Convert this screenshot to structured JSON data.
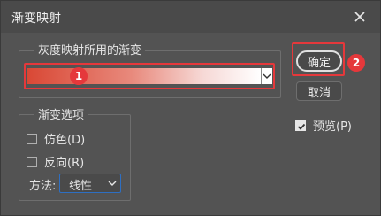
{
  "dialog": {
    "title": "渐变映射",
    "gradient_group_label": "灰度映射所用的渐变",
    "options_group_label": "渐变选项",
    "ok_label": "确定",
    "cancel_label": "取消",
    "preview_label": "预览(P)",
    "preview_checked": true,
    "dither_label": "仿色(D)",
    "dither_checked": false,
    "reverse_label": "反向(R)",
    "reverse_checked": false,
    "method_label": "方法:",
    "method_value": "线性",
    "gradient_colors": [
      "#d94835",
      "#e88a7d",
      "#f6d8d5",
      "#ffffff"
    ]
  },
  "annotations": {
    "badge_1": "1",
    "badge_2": "2",
    "highlight_color": "#e5383b"
  },
  "icons": {
    "close": "close-icon",
    "gradient_dropdown": "chevron-down-icon",
    "method_dropdown": "chevron-down-icon",
    "preview_check": "checkmark-icon"
  }
}
